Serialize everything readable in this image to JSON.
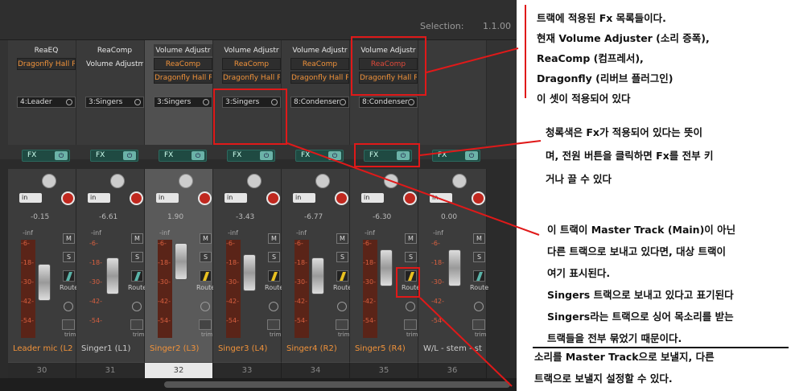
{
  "header": {
    "selection_label": "Selection:",
    "selection_value": "1.1.00"
  },
  "strips": [
    {
      "fx": [
        {
          "label": "ReaEQ",
          "style": "w"
        },
        {
          "label": "Dragonfly Hall Re",
          "style": "o"
        }
      ],
      "send": "4:Leader",
      "fx_button": "FX",
      "power": "⏻",
      "in_label": "in",
      "volume": "-0.15",
      "inf": "-inf",
      "mute": "M",
      "solo": "S",
      "route_label": "Route",
      "route_style": "teal",
      "trim_label": "trim",
      "name": "Leader mic (L2",
      "name_style": "o",
      "number": "30",
      "meter_red": true,
      "highlight": false
    },
    {
      "fx": [
        {
          "label": "ReaComp",
          "style": "w"
        },
        {
          "label": "Volume Adjustm",
          "style": "w"
        }
      ],
      "send": "3:Singers",
      "fx_button": "FX",
      "power": "⏻",
      "in_label": "in",
      "volume": "-6.61",
      "inf": "-inf",
      "mute": "M",
      "solo": "S",
      "route_label": "Route",
      "route_style": "teal",
      "trim_label": "trim",
      "name": "Singer1 (L1)",
      "name_style": "",
      "number": "31",
      "meter_red": false,
      "highlight": false
    },
    {
      "fx": [
        {
          "label": "Volume Adjustr",
          "style": "w"
        },
        {
          "label": "ReaComp",
          "style": "o"
        },
        {
          "label": "Dragonfly Hall R",
          "style": "o"
        }
      ],
      "send": "3:Singers",
      "fx_button": "FX",
      "power": "⏻",
      "in_label": "in",
      "volume": "1.90",
      "inf": "-inf",
      "mute": "M",
      "solo": "S",
      "route_label": "Route",
      "route_style": "",
      "trim_label": "trim",
      "name": "Singer2 (L3)",
      "name_style": "o",
      "number": "32",
      "meter_red": true,
      "highlight": true
    },
    {
      "fx": [
        {
          "label": "Volume Adjustr",
          "style": "w"
        },
        {
          "label": "ReaComp",
          "style": "o"
        },
        {
          "label": "Dragonfly Hall R",
          "style": "o"
        }
      ],
      "send": "3:Singers",
      "fx_button": "FX",
      "power": "⏻",
      "in_label": "in",
      "volume": "-3.43",
      "inf": "-inf",
      "mute": "M",
      "solo": "S",
      "route_label": "Route",
      "route_style": "",
      "trim_label": "trim",
      "name": "Singer3 (L4)",
      "name_style": "o",
      "number": "33",
      "meter_red": true,
      "highlight": false
    },
    {
      "fx": [
        {
          "label": "Volume Adjustr",
          "style": "w"
        },
        {
          "label": "ReaComp",
          "style": "o"
        },
        {
          "label": "Dragonfly Hall R",
          "style": "o"
        }
      ],
      "send": "8:Condenser",
      "fx_button": "FX",
      "power": "⏻",
      "in_label": "in",
      "volume": "-6.77",
      "inf": "-inf",
      "mute": "M",
      "solo": "S",
      "route_label": "Route",
      "route_style": "",
      "trim_label": "trim",
      "name": "Singer4 (R2)",
      "name_style": "o",
      "number": "34",
      "meter_red": true,
      "highlight": false
    },
    {
      "fx": [
        {
          "label": "Volume Adjustr",
          "style": "w"
        },
        {
          "label": "ReaComp",
          "style": "r"
        },
        {
          "label": "Dragonfly Hall R",
          "style": "o"
        }
      ],
      "send": "8:Condenser",
      "fx_button": "FX",
      "power": "⏻",
      "in_label": "in",
      "volume": "-6.30",
      "inf": "-inf",
      "mute": "M",
      "solo": "S",
      "route_label": "Route",
      "route_style": "",
      "trim_label": "trim",
      "name": "Singer5 (R4)",
      "name_style": "o",
      "number": "35",
      "meter_red": true,
      "highlight": false
    },
    {
      "fx": [],
      "send": "",
      "fx_button": "FX",
      "power": "⏻",
      "in_label": "in",
      "volume": "0.00",
      "inf": "-inf",
      "mute": "M",
      "solo": "S",
      "route_label": "Route",
      "route_style": "teal",
      "trim_label": "trim",
      "name": "W/L - stem - st",
      "name_style": "",
      "number": "36",
      "meter_red": false,
      "highlight": false
    }
  ],
  "annotations": {
    "fx_list": [
      "트랙에 적용된 Fx 목록들이다.",
      "현재 Volume Adjuster (소리 증폭),",
      "ReaComp (컴프레서),",
      "Dragonfly (리버브 플러그인)",
      "이 셋이 적용되어 있다"
    ],
    "fx_button": [
      "청록색은 Fx가 적용되어 있다는 뜻이",
      "며, 전원 버튼을 클릭하면 Fx를 전부 키",
      "거나 끌 수 있다"
    ],
    "send_target": [
      "이 트랙이 Master Track (Main)이 아닌",
      "다른 트랙으로 보내고 있다면, 대상 트랙이",
      "여기 표시된다.",
      "Singers 트랙으로 보내고 있다고 표기된다",
      "Singers라는 트랙으로 싱어 목소리를 받는",
      "트랙들을 전부 묶었기 때문이다."
    ],
    "route": [
      "소리를 Master Track으로 보낼지, 다른",
      "트랙으로 보낼지 설정할 수 있다."
    ]
  },
  "colors": {
    "annotation_red": "#e01919",
    "fx_teal": "#1f4a42",
    "fx_orange": "#f0923a"
  }
}
